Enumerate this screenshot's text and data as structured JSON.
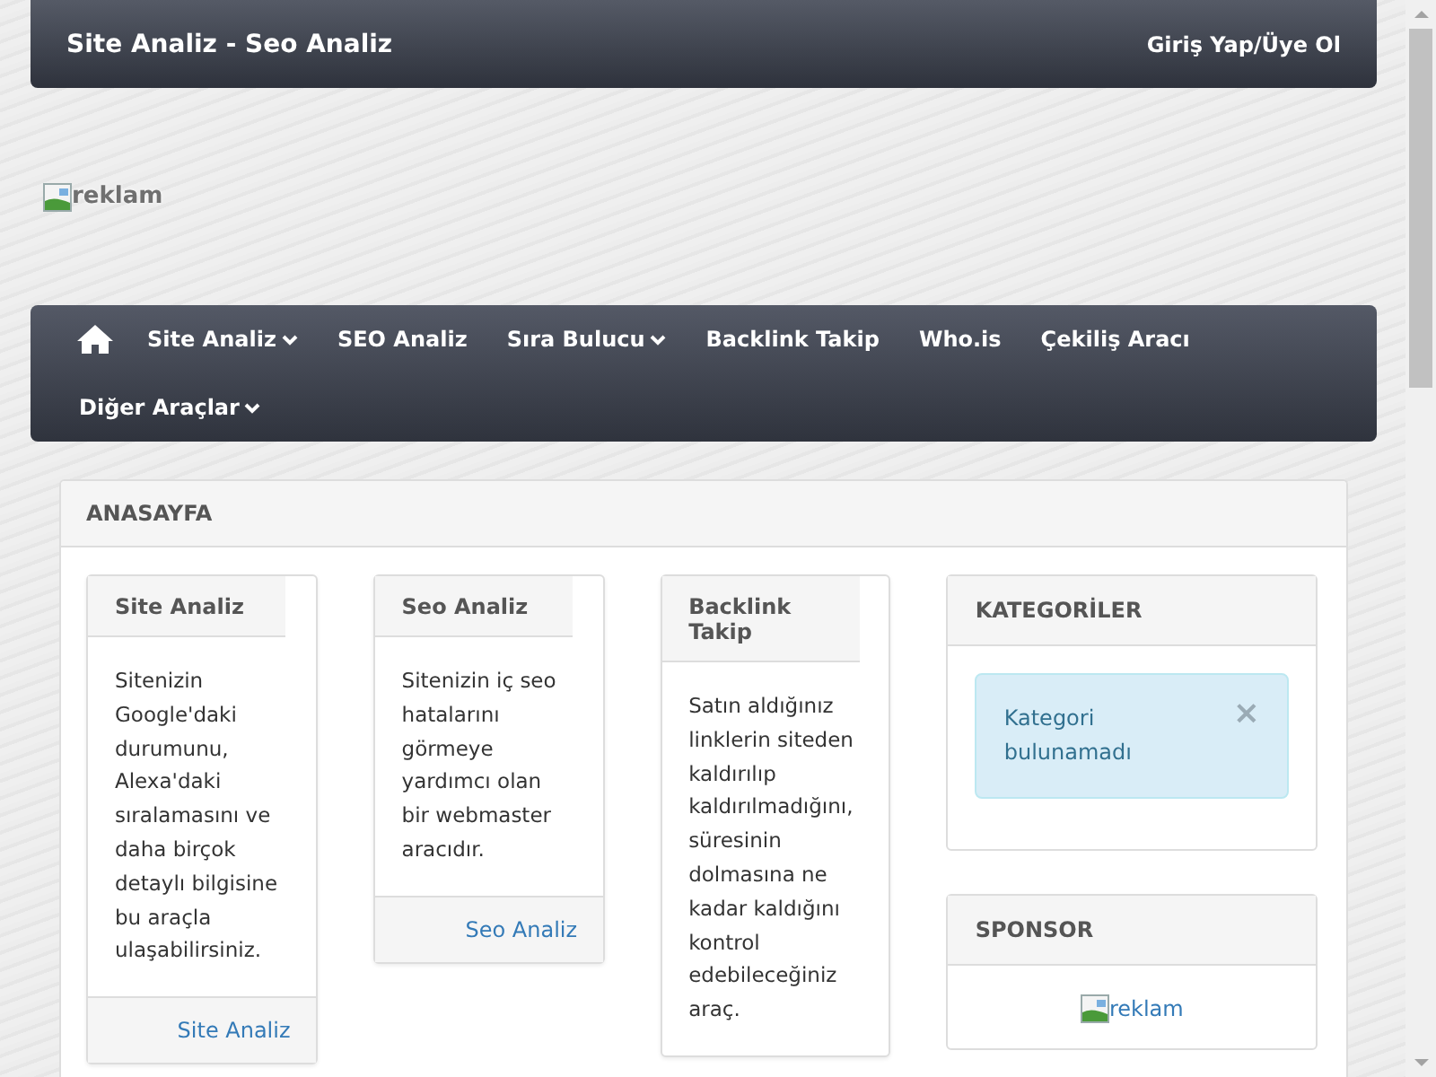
{
  "header": {
    "title": "Site Analiz - Seo Analiz",
    "login": "Giriş Yap/Üye Ol"
  },
  "top_ad": {
    "alt": "reklam"
  },
  "nav": [
    {
      "kind": "home"
    },
    {
      "kind": "link",
      "label": "Site Analiz",
      "dropdown": true
    },
    {
      "kind": "link",
      "label": "SEO Analiz",
      "dropdown": false
    },
    {
      "kind": "link",
      "label": "Sıra Bulucu",
      "dropdown": true
    },
    {
      "kind": "link",
      "label": "Backlink Takip",
      "dropdown": false
    },
    {
      "kind": "link",
      "label": "Who.is",
      "dropdown": false
    },
    {
      "kind": "link",
      "label": "Çekiliş Aracı",
      "dropdown": false
    },
    {
      "kind": "link",
      "label": "Diğer Araçlar",
      "dropdown": true
    }
  ],
  "main": {
    "title": "ANASAYFA",
    "cards": [
      {
        "title": "Site Analiz",
        "text": "Sitenizin Google'daki durumunu, Alexa'daki sıralamasını ve daha birçok detaylı bilgisine bu araçla ulaşabilirsiniz.",
        "link": "Site Analiz"
      },
      {
        "title": "Seo Analiz",
        "text": "Sitenizin iç seo hatalarını görmeye yardımcı olan bir webmaster aracıdır.",
        "link": "Seo Analiz"
      },
      {
        "title": "Backlink Takip",
        "text": "Satın aldığınız linklerin siteden kaldırılıp kaldırılmadığını, süresinin dolmasına ne kadar kaldığını kontrol edebileceğiniz araç."
      }
    ]
  },
  "sidebar": [
    {
      "kind": "alert",
      "title": "KATEGORİLER",
      "message": "Kategori bulunamadı",
      "close": "×"
    },
    {
      "kind": "image",
      "title": "SPONSOR",
      "alt": "reklam"
    }
  ]
}
